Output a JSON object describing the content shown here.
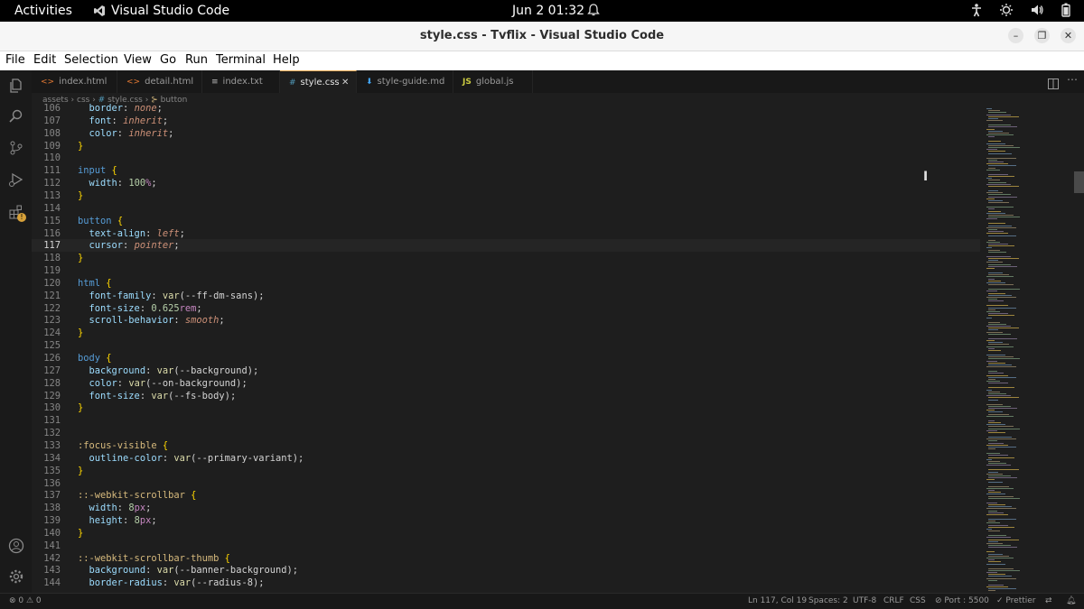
{
  "system": {
    "activities": "Activities",
    "app_name": "Visual Studio Code",
    "clock": "Jun 2  01:32"
  },
  "window": {
    "title": "style.css - Tvflix - Visual Studio Code"
  },
  "menu": [
    "File",
    "Edit",
    "Selection",
    "View",
    "Go",
    "Run",
    "Terminal",
    "Help"
  ],
  "tabs": [
    {
      "label": "index.html",
      "icon": "<>"
    },
    {
      "label": "detail.html",
      "icon": "<>"
    },
    {
      "label": "index.txt",
      "icon": "≡"
    },
    {
      "label": "style.css",
      "icon": "#"
    },
    {
      "label": "style-guide.md",
      "icon": "⬇"
    },
    {
      "label": "global.js",
      "icon": "JS"
    }
  ],
  "breadcrumb": {
    "seg1": "assets",
    "seg2": "css",
    "seg3": "style.css",
    "seg4": "button"
  },
  "editor": {
    "current_line": 117,
    "lines": [
      [
        106,
        [
          [
            "prop",
            "  border"
          ],
          [
            "p",
            ": "
          ],
          [
            "val",
            "none"
          ],
          [
            "p",
            ";"
          ]
        ]
      ],
      [
        107,
        [
          [
            "prop",
            "  font"
          ],
          [
            "p",
            ": "
          ],
          [
            "val",
            "inherit"
          ],
          [
            "p",
            ";"
          ]
        ]
      ],
      [
        108,
        [
          [
            "prop",
            "  color"
          ],
          [
            "p",
            ": "
          ],
          [
            "val",
            "inherit"
          ],
          [
            "p",
            ";"
          ]
        ]
      ],
      [
        109,
        [
          [
            "br",
            "}"
          ]
        ]
      ],
      [
        110,
        []
      ],
      [
        111,
        [
          [
            "tag",
            "input"
          ],
          [
            "p",
            " "
          ],
          [
            "br",
            "{"
          ]
        ]
      ],
      [
        112,
        [
          [
            "prop",
            "  width"
          ],
          [
            "p",
            ": "
          ],
          [
            "num",
            "100"
          ],
          [
            "unit",
            "%"
          ],
          [
            "p",
            ";"
          ]
        ]
      ],
      [
        113,
        [
          [
            "br",
            "}"
          ]
        ]
      ],
      [
        114,
        []
      ],
      [
        115,
        [
          [
            "tag",
            "button"
          ],
          [
            "p",
            " "
          ],
          [
            "br",
            "{"
          ]
        ]
      ],
      [
        116,
        [
          [
            "prop",
            "  text-align"
          ],
          [
            "p",
            ": "
          ],
          [
            "val",
            "left"
          ],
          [
            "p",
            ";"
          ]
        ]
      ],
      [
        117,
        [
          [
            "prop",
            "  cursor"
          ],
          [
            "p",
            ": "
          ],
          [
            "val",
            "pointer"
          ],
          [
            "p",
            ";"
          ]
        ]
      ],
      [
        118,
        [
          [
            "br",
            "}"
          ]
        ]
      ],
      [
        119,
        []
      ],
      [
        120,
        [
          [
            "tag",
            "html"
          ],
          [
            "p",
            " "
          ],
          [
            "br",
            "{"
          ]
        ]
      ],
      [
        121,
        [
          [
            "prop",
            "  font-family"
          ],
          [
            "p",
            ": "
          ],
          [
            "fn",
            "var"
          ],
          [
            "p",
            "(--ff-dm-sans);"
          ]
        ]
      ],
      [
        122,
        [
          [
            "prop",
            "  font-size"
          ],
          [
            "p",
            ": "
          ],
          [
            "num",
            "0.625"
          ],
          [
            "unit",
            "rem"
          ],
          [
            "p",
            ";"
          ]
        ]
      ],
      [
        123,
        [
          [
            "prop",
            "  scroll-behavior"
          ],
          [
            "p",
            ": "
          ],
          [
            "val",
            "smooth"
          ],
          [
            "p",
            ";"
          ]
        ]
      ],
      [
        124,
        [
          [
            "br",
            "}"
          ]
        ]
      ],
      [
        125,
        []
      ],
      [
        126,
        [
          [
            "tag",
            "body"
          ],
          [
            "p",
            " "
          ],
          [
            "br",
            "{"
          ]
        ]
      ],
      [
        127,
        [
          [
            "prop",
            "  background"
          ],
          [
            "p",
            ": "
          ],
          [
            "fn",
            "var"
          ],
          [
            "p",
            "(--background);"
          ]
        ]
      ],
      [
        128,
        [
          [
            "prop",
            "  color"
          ],
          [
            "p",
            ": "
          ],
          [
            "fn",
            "var"
          ],
          [
            "p",
            "(--on-background);"
          ]
        ]
      ],
      [
        129,
        [
          [
            "prop",
            "  font-size"
          ],
          [
            "p",
            ": "
          ],
          [
            "fn",
            "var"
          ],
          [
            "p",
            "(--fs-body);"
          ]
        ]
      ],
      [
        130,
        [
          [
            "br",
            "}"
          ]
        ]
      ],
      [
        131,
        []
      ],
      [
        132,
        []
      ],
      [
        133,
        [
          [
            "sel",
            ":focus-visible"
          ],
          [
            "p",
            " "
          ],
          [
            "br",
            "{"
          ]
        ]
      ],
      [
        134,
        [
          [
            "prop",
            "  outline-color"
          ],
          [
            "p",
            ": "
          ],
          [
            "fn",
            "var"
          ],
          [
            "p",
            "(--primary-variant);"
          ]
        ]
      ],
      [
        135,
        [
          [
            "br",
            "}"
          ]
        ]
      ],
      [
        136,
        []
      ],
      [
        137,
        [
          [
            "sel",
            "::-webkit-scrollbar"
          ],
          [
            "p",
            " "
          ],
          [
            "br",
            "{"
          ]
        ]
      ],
      [
        138,
        [
          [
            "prop",
            "  width"
          ],
          [
            "p",
            ": "
          ],
          [
            "num",
            "8"
          ],
          [
            "unit",
            "px"
          ],
          [
            "p",
            ";"
          ]
        ]
      ],
      [
        139,
        [
          [
            "prop",
            "  height"
          ],
          [
            "p",
            ": "
          ],
          [
            "num",
            "8"
          ],
          [
            "unit",
            "px"
          ],
          [
            "p",
            ";"
          ]
        ]
      ],
      [
        140,
        [
          [
            "br",
            "}"
          ]
        ]
      ],
      [
        141,
        []
      ],
      [
        142,
        [
          [
            "sel",
            "::-webkit-scrollbar-thumb"
          ],
          [
            "p",
            " "
          ],
          [
            "br",
            "{"
          ]
        ]
      ],
      [
        143,
        [
          [
            "prop",
            "  background"
          ],
          [
            "p",
            ": "
          ],
          [
            "fn",
            "var"
          ],
          [
            "p",
            "(--banner-background);"
          ]
        ]
      ],
      [
        144,
        [
          [
            "prop",
            "  border-radius"
          ],
          [
            "p",
            ": "
          ],
          [
            "fn",
            "var"
          ],
          [
            "p",
            "(--radius-8);"
          ]
        ]
      ]
    ]
  },
  "status": {
    "problems": "⊗ 0 ⚠ 0",
    "position": "Ln 117, Col 19",
    "spaces": "Spaces: 2",
    "encoding": "UTF-8",
    "eol": "CRLF",
    "language": "CSS",
    "port": "⊘ Port : 5500",
    "prettier": "✓ Prettier"
  },
  "colors": {
    "accent": "#e8ab53",
    "editor_bg": "#1e1e1e"
  }
}
